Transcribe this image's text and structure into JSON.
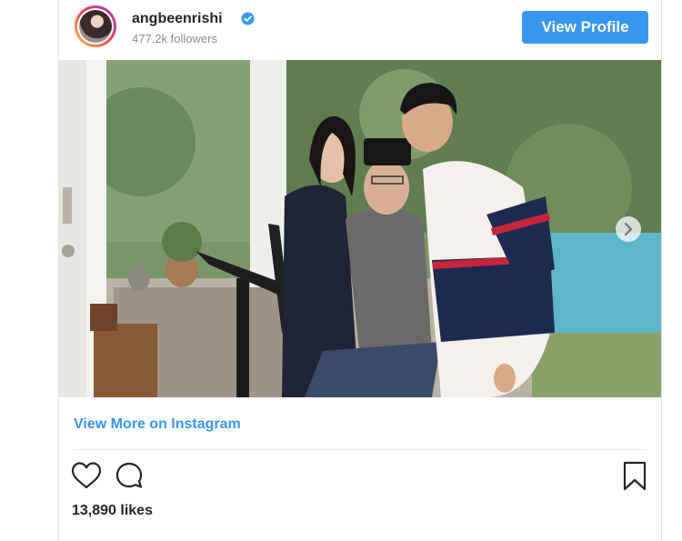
{
  "header": {
    "username": "angbeenrishi",
    "followers": "477.2k followers",
    "view_profile_label": "View Profile",
    "verified_icon": "verified-badge-icon"
  },
  "post": {
    "view_more_label": "View More on Instagram",
    "likes": "13,890 likes",
    "icons": [
      "heart-icon",
      "comment-icon",
      "bookmark-icon",
      "chevron-right-icon"
    ]
  },
  "colors": {
    "accent": "#3897f0",
    "text": "#262626",
    "muted": "#8e8e8e"
  }
}
